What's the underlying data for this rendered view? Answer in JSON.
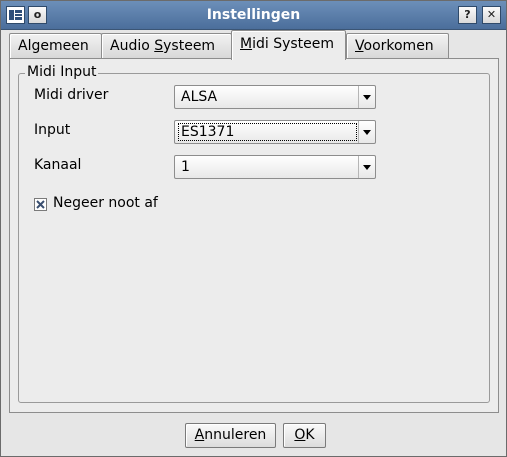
{
  "window": {
    "title": "Instellingen",
    "help_button": "?",
    "close_button": "✕",
    "menu_button": "o"
  },
  "tabs": [
    {
      "label_pre": "Algemeen",
      "label_u": "",
      "label_post": ""
    },
    {
      "label_pre": "Audio ",
      "label_u": "S",
      "label_post": "ysteem"
    },
    {
      "label_pre": "",
      "label_u": "M",
      "label_post": "idi Systeem"
    },
    {
      "label_pre": "",
      "label_u": "V",
      "label_post": "oorkomen"
    }
  ],
  "active_tab": "Midi Systeem",
  "group": {
    "title": "Midi Input",
    "rows": [
      {
        "label": "Midi driver",
        "value": "ALSA"
      },
      {
        "label": "Input",
        "value": "ES1371"
      },
      {
        "label": "Kanaal",
        "value": "1"
      }
    ],
    "checkbox": {
      "label": "Negeer noot af",
      "checked": true
    }
  },
  "buttons": {
    "cancel_u": "A",
    "cancel_rest": "nnuleren",
    "ok_u": "O",
    "ok_rest": "K"
  }
}
